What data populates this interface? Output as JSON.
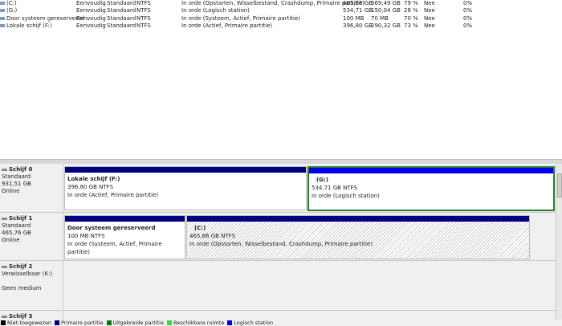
{
  "volumes": [
    {
      "name": "(C:)",
      "layout": "Eenvoudig",
      "type": "Standaard",
      "fs": "NTFS",
      "status": "In orde (Opstarten, Wisselbestand, Crashdump, Primaire partitie)",
      "capacity": "465,66 GB",
      "free": "369,49 GB",
      "pct": "79 %",
      "fault": "Nee",
      "overhead": "0%"
    },
    {
      "name": "(G:)",
      "layout": "Eenvoudig",
      "type": "Standaard",
      "fs": "NTFS",
      "status": "In orde (Logisch station)",
      "capacity": "534,71 GB",
      "free": "150,04 GB",
      "pct": "28 %",
      "fault": "Nee",
      "overhead": "0%"
    },
    {
      "name": "Door systeem gereserveerd",
      "layout": "Eenvoudig",
      "type": "Standaard",
      "fs": "NTFS",
      "status": "In orde (Systeem, Actief, Primaire partitie)",
      "capacity": "100 MB",
      "free": "70 MB",
      "pct": "70 %",
      "fault": "Nee",
      "overhead": "0%"
    },
    {
      "name": "Lokale schijf (F:)",
      "layout": "Eenvoudig",
      "type": "Standaard",
      "fs": "NTFS",
      "status": "In orde (Actief, Primaire partitie)",
      "capacity": "396,80 GB",
      "free": "290,32 GB",
      "pct": "73 %",
      "fault": "Nee",
      "overhead": "0%"
    }
  ],
  "disks": [
    {
      "name": "Schijf 0",
      "type": "Standaard",
      "size": "931,51 GB",
      "state": "Online",
      "partitions": [
        {
          "title": "Lokale schijf  (F:)",
          "size": "396,80 GB NTFS",
          "status": "In orde (Actief, Primaire partitie)"
        },
        {
          "title": "(G:)",
          "size": "534,71 GB NTFS",
          "status": "In orde (Logisch station)"
        }
      ]
    },
    {
      "name": "Schijf 1",
      "type": "Standaard",
      "size": "465,76 GB",
      "state": "Online",
      "partitions": [
        {
          "title": "Door systeem gereserveerd",
          "size": "100 MB NTFS",
          "status": "In orde (Systeem, Actief, Primaire partitie)"
        },
        {
          "title": "(C:)",
          "size": "465,66 GB NTFS",
          "status": "In orde (Opstarten, Wisselbestand, Crashdump, Primaire partitie)"
        }
      ]
    },
    {
      "name": "Schijf 2",
      "type": "Verwisselbaar (K:)",
      "state": "Geen medium"
    },
    {
      "name": "Schijf 3"
    }
  ],
  "legend": [
    {
      "label": "Niet-toegewezen",
      "color": "#000000"
    },
    {
      "label": "Primaire partitie",
      "color": "#000080"
    },
    {
      "label": "Uitgebreide partitie",
      "color": "#008000"
    },
    {
      "label": "Beschikbare ruimte",
      "color": "#33dd33"
    },
    {
      "label": "Logisch station",
      "color": "#0000ee"
    }
  ]
}
